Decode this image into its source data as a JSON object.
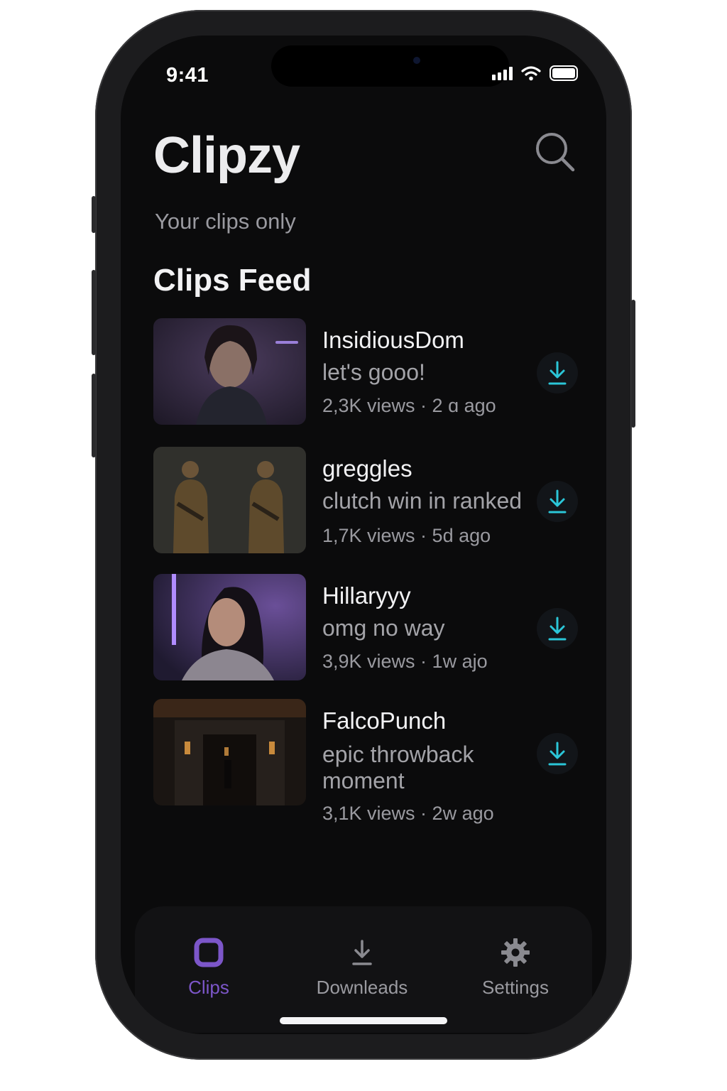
{
  "status_bar": {
    "time": "9:41"
  },
  "app": {
    "title": "Clipzy",
    "subtitle": "Your clips only",
    "section_title": "Clips Feed",
    "accent_color": "#7c56c9",
    "download_color": "#2bc6d8"
  },
  "clips": [
    {
      "user": "InsidiousDom",
      "caption": "let's gooo!",
      "meta": "2,3K views · 2 ɑ ago",
      "thumb": "woman-portrait-purple"
    },
    {
      "user": "greggles",
      "caption": "clutch win in ranked",
      "meta": "1,7K views · 5d ago",
      "thumb": "two-soldiers"
    },
    {
      "user": "Hillaryyy",
      "caption": "omg no way",
      "meta": "3,9K views · 1w ajo",
      "thumb": "streamer-neon"
    },
    {
      "user": "FalcoPunch",
      "caption": "epic throwback moment",
      "meta": "3,1K views · 2w ago",
      "thumb": "dark-building"
    }
  ],
  "tabs": [
    {
      "label": "Clips",
      "icon": "clips-square-icon",
      "active": true
    },
    {
      "label": "Downleads",
      "icon": "download-icon",
      "active": false
    },
    {
      "label": "Settings",
      "icon": "gear-icon",
      "active": false
    }
  ]
}
